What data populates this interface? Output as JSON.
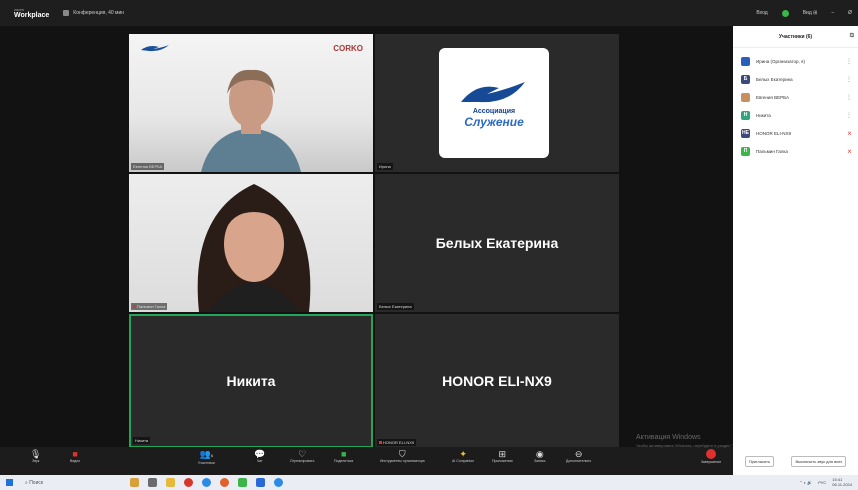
{
  "titlebar": {
    "brand_small": "zoom",
    "brand_big": "Workplace",
    "conference": "Конференция, 40 мин",
    "sign_in": "Вход",
    "view": "Вид ⊞",
    "minimize": "–",
    "close": "Ø"
  },
  "tiles": {
    "t1_name": "Евгения ВЕРБА",
    "t1_brand": "CORKO",
    "t2_name": "Ирина",
    "t2_assoc": "Ассоциация",
    "t2_slu": "Служение",
    "t3_name": "Пальмин Галка",
    "t4_center": "Белых Екатерина",
    "t4_name": "Белых Екатерина",
    "t5_center": "Никита",
    "t5_name": "Никита",
    "t6_center": "HONOR ELI-NX9",
    "t6_name": "HONOR ELI-NX9"
  },
  "panel": {
    "title": "Участники (6)",
    "participants": [
      {
        "name": "Ирина (Организатор, я)",
        "color": "#2a5fb8",
        "initial": "",
        "mic_off": false
      },
      {
        "name": "Белых Екатерина",
        "color": "#3a4a7a",
        "initial": "Б",
        "mic_off": false
      },
      {
        "name": "Евгения ВЕРБА",
        "color": "#c89060",
        "initial": "",
        "mic_off": false
      },
      {
        "name": "Никита",
        "color": "#2fa77a",
        "initial": "Н",
        "mic_off": false
      },
      {
        "name": "HONOR ELI-NX9",
        "color": "#3a4a7a",
        "initial": "HE",
        "mic_off": true
      },
      {
        "name": "Пальмин Галка",
        "color": "#3bb54a",
        "initial": "П",
        "mic_off": true
      }
    ],
    "invite": "Пригласить",
    "mute_all": "Выключить звук для всех"
  },
  "toolbar": {
    "audio": "Звук",
    "video": "Видео",
    "participants": "Участники",
    "participants_count": "6",
    "chat": "Чат",
    "react": "Отреагировать",
    "share": "Поделиться",
    "host_tools": "Инструменты организатора",
    "ai_companion": "AI Companion",
    "apps": "Приложения",
    "record": "Запись",
    "more": "Дополнительно",
    "end": "Завершение"
  },
  "watermark": {
    "title": "Активация Windows",
    "sub": "Чтобы активировать Windows, перейдите в раздел \"Параметры\"."
  },
  "taskbar": {
    "search": "Поиск",
    "lang": "РУС",
    "time": "15:41",
    "date": "06.11.2024"
  }
}
